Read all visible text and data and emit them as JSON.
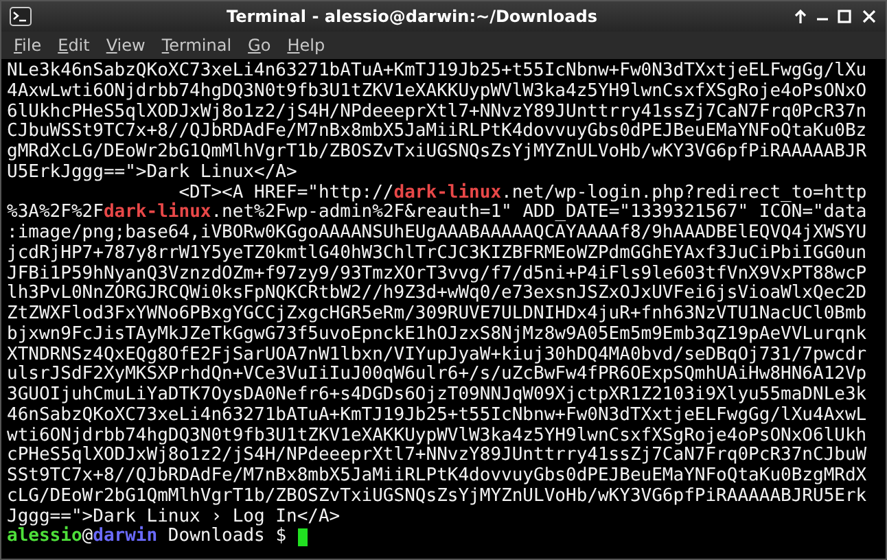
{
  "window": {
    "title": "Terminal - alessio@darwin:~/Downloads"
  },
  "menu": [
    "File",
    "Edit",
    "View",
    "Terminal",
    "Go",
    "Help"
  ],
  "lines": [
    [
      {
        "kind": "plain",
        "text": "NLe3k46nSabzQKoXC73xeLi4n63271bATuA+KmTJ19Jb25+t55IcNbnw+Fw0N3dTXxtjeELFwgGg/lXu"
      }
    ],
    [
      {
        "kind": "plain",
        "text": "4AxwLwti6ONjdrbb74hgDQ3N0t9fb3U1tZKV1eXAKKUypWVlW3ka4z5YH9lwnCsxfXSgRoje4oPsONxO"
      }
    ],
    [
      {
        "kind": "plain",
        "text": "6lUkhcPHeS5qlXODJxWj8o1z2/jS4H/NPdeeeprXtl7+NNvzY89JUnttrry41ssZj7CaN7Frq0PcR37n"
      }
    ],
    [
      {
        "kind": "plain",
        "text": "CJbuWSSt9TC7x+8//QJbRDAdFe/M7nBx8mbX5JaMiiRLPtK4dovvuyGbs0dPEJBeuEMaYNFoQtaKu0Bz"
      }
    ],
    [
      {
        "kind": "plain",
        "text": "gMRdXcLG/DEoWr2bG1QmMlhVgrT1b/ZBOSZvTxiUGSNQsZsYjMYZnULVoHb/wKY3VG6pfPiRAAAAABJR"
      }
    ],
    [
      {
        "kind": "plain",
        "text": "U5ErkJggg==\">Dark Linux</A>"
      }
    ],
    [
      {
        "kind": "plain",
        "text": "                <DT><A HREF=\"http://"
      },
      {
        "kind": "highlight",
        "text": "dark-linux"
      },
      {
        "kind": "plain",
        "text": ".net/wp-login.php?redirect_to=http"
      }
    ],
    [
      {
        "kind": "plain",
        "text": "%3A%2F%2F"
      },
      {
        "kind": "highlight",
        "text": "dark-linux"
      },
      {
        "kind": "plain",
        "text": ".net%2Fwp-admin%2F&reauth=1\" ADD_DATE=\"1339321567\" ICON=\"data"
      }
    ],
    [
      {
        "kind": "plain",
        "text": ":image/png;base64,iVBORw0KGgoAAAANSUhEUgAAABAAAAAQCAYAAAAf8/9hAAADBElEQVQ4jXWSYU"
      }
    ],
    [
      {
        "kind": "plain",
        "text": "jcdRjHP7+787y8rrW1Y5yeTZ0kmtlG40hW3ChlTrCJC3KIZBFRMEoWZPdmGGhEYAxf3JuCiPbiIGG0un"
      }
    ],
    [
      {
        "kind": "plain",
        "text": "JFBi1P59hNyanQ3VznzdOZm+f97zy9/93TmzXOrT3vvg/f7/d5ni+P4iFls9le603tfVnX9VxPT88wcP"
      }
    ],
    [
      {
        "kind": "plain",
        "text": "lh3PvL0NnZORGJRCQWi0ksFpNQKCRtbW2//h9Z3d+wWq0/e73exsnJSZxOJxUVFei6jsVioaWlxQec2D"
      }
    ],
    [
      {
        "kind": "plain",
        "text": "ZtZWXFlod3FxYWNo6PBxgYGCCjZxgcHGR5eRm/309RUVE7ULDNIHDx4juR+fnh63NzVTU1NacUCl0Bmb"
      }
    ],
    [
      {
        "kind": "plain",
        "text": "bjxwn9FcJisTAyMkJZeTkGgwG73f5uvoEpnckE1hOJzxS8NjMz8w9A05Em5m9Emb3qZ19pAeVVLurqnk"
      }
    ],
    [
      {
        "kind": "plain",
        "text": "XTNDRNSz4QxEQg8OfE2FjSarUOA7nW1lbxn/VIYupJyaW+kiuj30hDQ4MA0bvd/seDBqOj731/7pwcdr"
      }
    ],
    [
      {
        "kind": "plain",
        "text": "ulsrJSdF2XyMKSXPrhdQn+VCe3VuIiIuJ00qW6ulr6+/s/uZcBwFw4fPR6OExpSQmhUAiHw8HN6A12Vp"
      }
    ],
    [
      {
        "kind": "plain",
        "text": "3GUOIjuhCmuLiYaDTK7OysDA0Nefr6+s4DGDs6OjzT09NNJqW09XjctpXR1Z2103i9Xlyu55maDNLe3k"
      }
    ],
    [
      {
        "kind": "plain",
        "text": "46nSabzQKoXC73xeLi4n63271bATuA+KmTJ19Jb25+t55IcNbnw+Fw0N3dTXxtjeELFwgGg/lXu4AxwL"
      }
    ],
    [
      {
        "kind": "plain",
        "text": "wti6ONjdrbb74hgDQ3N0t9fb3U1tZKV1eXAKKUypWVlW3ka4z5YH9lwnCsxfXSgRoje4oPsONxO6lUkh"
      }
    ],
    [
      {
        "kind": "plain",
        "text": "cPHeS5qlXODJxWj8o1z2/jS4H/NPdeeeprXtl7+NNvzY89JUnttrry41ssZj7CaN7Frq0PcR37nCJbuW"
      }
    ],
    [
      {
        "kind": "plain",
        "text": "SSt9TC7x+8//QJbRDAdFe/M7nBx8mbX5JaMiiRLPtK4dovvuyGbs0dPEJBeuEMaYNFoQtaKu0BzgMRdX"
      }
    ],
    [
      {
        "kind": "plain",
        "text": "cLG/DEoWr2bG1QmMlhVgrT1b/ZBOSZvTxiUGSNQsZsYjMYZnULVoHb/wKY3VG6pfPiRAAAAABJRU5Erk"
      }
    ],
    [
      {
        "kind": "plain",
        "text": "Jggg==\">Dark Linux › Log In</A>"
      }
    ]
  ],
  "prompt": {
    "user": "alessio",
    "at": "@",
    "host": "darwin",
    "cwd": "Downloads",
    "symbol": "$"
  }
}
